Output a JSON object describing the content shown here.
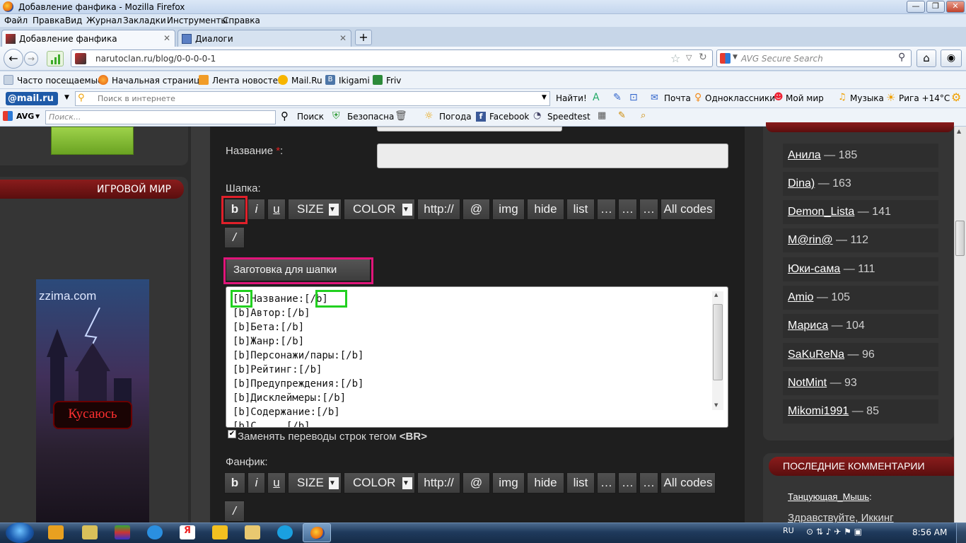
{
  "window": {
    "title": "Добавление фанфика - Mozilla Firefox"
  },
  "menu": [
    "Файл",
    "Правка",
    "Вид",
    "Журнал",
    "Закладки",
    "Инструменты",
    "Справка"
  ],
  "tabs": [
    {
      "label": "Добавление фанфика",
      "active": true
    },
    {
      "label": "Диалоги",
      "active": false
    }
  ],
  "nav": {
    "url": "narutoclan.ru/blog/0-0-0-0-1",
    "search_placeholder": "AVG Secure Search"
  },
  "bookmarks": [
    "Часто посещаемые",
    "Начальная страница",
    "Лента новостей",
    "Mail.Ru",
    "Ikigami",
    "Friv"
  ],
  "mailbar": {
    "logo": "@mail.ru",
    "search_placeholder": "Поиск в интернете",
    "find_label": "Найти!",
    "items": [
      "Почта",
      "Одноклассники",
      "Мой мир",
      "Музыка",
      "Рига +14°C"
    ]
  },
  "avgbar": {
    "logo": "AVG",
    "search_placeholder": "Поиск...",
    "items": [
      "Поиск",
      "Безопасна",
      "Погода",
      "Facebook",
      "Speedtest"
    ]
  },
  "left": {
    "game_header": "ИГРОВОЙ МИР",
    "banner_site": "zzima.com",
    "banner_title": "Кусаюсь"
  },
  "form": {
    "title_label": "Название",
    "required_mark": "*",
    "title_colon": ":",
    "header_label": "Шапка:",
    "fanfic_label": "Фанфик:",
    "toolbar": [
      "b",
      "i",
      "u",
      "SIZE",
      "COLOR",
      "http://",
      "@",
      "img",
      "hide",
      "list",
      "…",
      "…",
      "…",
      "All codes",
      "/"
    ],
    "preset_button": "Заготовка для шапки",
    "textarea_lines": [
      "[b]Название:[/b]",
      "[b]Автор:[/b]",
      "[b]Бета:[/b]",
      "[b]Жанр:[/b]",
      "[b]Персонажи/пары:[/b]",
      "[b]Рейтинг:[/b]",
      "[b]Предупреждения:[/b]",
      "[b]Дисклеймеры:[/b]",
      "[b]Содержание:[/b]",
      "[b]С     [/b]"
    ],
    "br_checkbox_label": "Заменять переводы строк тегом",
    "br_tag": "<BR>",
    "br_checked": true
  },
  "sidebar": {
    "top_users": [
      {
        "name": "Анила",
        "count": "— 185"
      },
      {
        "name": "Dina)",
        "count": "— 163"
      },
      {
        "name": "Demon_Lista",
        "count": "— 141"
      },
      {
        "name": "M@rin@",
        "count": "— 112"
      },
      {
        "name": "Юки-сама",
        "count": "— 111"
      },
      {
        "name": "Amio",
        "count": "— 105"
      },
      {
        "name": "Мариса",
        "count": "— 104"
      },
      {
        "name": "SaKuReNa",
        "count": "— 96"
      },
      {
        "name": "NotMint",
        "count": "— 93"
      },
      {
        "name": "Mikomi1991",
        "count": "— 85"
      }
    ],
    "comments_header": "ПОСЛЕДНИЕ КОММЕНТАРИИ",
    "comment_user": "Танцующая_Мышь",
    "comment_colon": ":",
    "comment_text": "Здравствуйте, Иккинг"
  },
  "taskbar": {
    "lang": "RU",
    "clock": "8:56 AM"
  },
  "colors": {
    "highlight_red": "#e0202a",
    "highlight_pink": "#e0157a",
    "highlight_green": "#22d020",
    "section_header": "#8a1c1c"
  }
}
